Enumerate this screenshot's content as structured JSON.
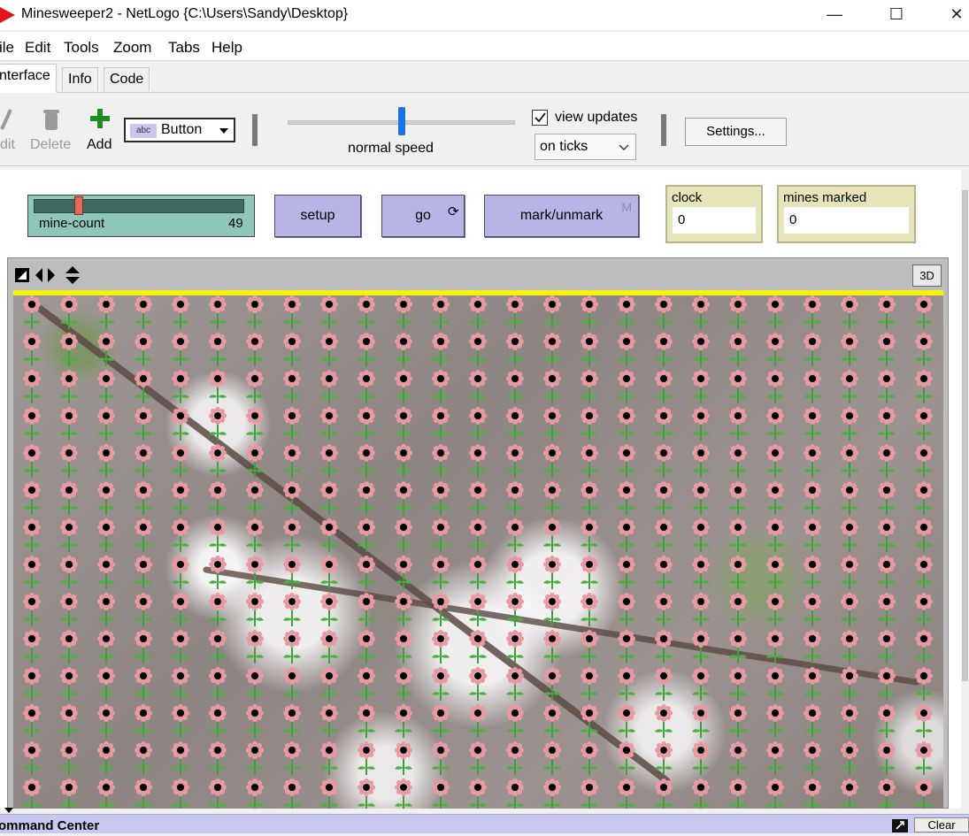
{
  "window": {
    "title": "Minesweeper2 - NetLogo {C:\\Users\\Sandy\\Desktop}",
    "minimize": "—",
    "maximize": "☐",
    "close": "✕"
  },
  "menu": [
    "ile",
    "Edit",
    "Tools",
    "Zoom",
    "Tabs",
    "Help"
  ],
  "tabs": [
    "nterface",
    "Info",
    "Code"
  ],
  "toolbar": {
    "edit_label": "dit",
    "delete_label": "Delete",
    "add_label": "Add",
    "widget_type": "Button",
    "widget_icon_text": "abc",
    "speed_label": "normal speed",
    "speed_level": 0.5,
    "view_updates_label": "view updates",
    "view_updates_checked": true,
    "update_mode": "on ticks",
    "settings_label": "Settings..."
  },
  "widgets": {
    "slider": {
      "name": "mine-count",
      "value": "49",
      "fraction": 0.2
    },
    "setup_label": "setup",
    "go_label": "go",
    "go_forever_icon": "⟳",
    "mark_label": "mark/unmark",
    "mark_key": "M",
    "clock": {
      "label": "clock",
      "value": "0"
    },
    "mines_marked": {
      "label": "mines marked",
      "value": "0"
    }
  },
  "view": {
    "three_d_label": "3D",
    "accent": "#f5f20e"
  },
  "command_center": {
    "title": "ommand Center",
    "clear_label": "Clear"
  },
  "colors": {
    "slider": "#8ec7ba",
    "button": "#b9b4e6",
    "monitor": "#e6e4b9",
    "flower_petal": "#e89aa3",
    "flower_stem": "#3aa33a"
  }
}
